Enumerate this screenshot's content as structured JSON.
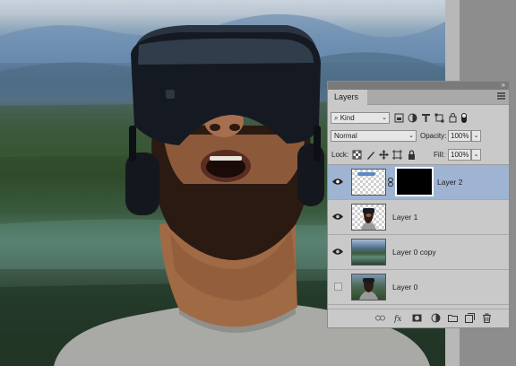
{
  "panel": {
    "tab_label": "Layers",
    "collapse_glyph": "»",
    "filter": {
      "kind_label": "Kind",
      "kind_icon": "search-icon"
    },
    "blend_mode": "Normal",
    "opacity_label": "Opacity:",
    "opacity_value": "100%",
    "lock_label": "Lock:",
    "fill_label": "Fill:",
    "fill_value": "100%",
    "layers": [
      {
        "name": "Layer 2",
        "visible": true,
        "selected": true,
        "has_mask": true,
        "thumb": "transparent-stroke"
      },
      {
        "name": "Layer 1",
        "visible": true,
        "selected": false,
        "has_mask": false,
        "thumb": "person-cutout"
      },
      {
        "name": "Layer 0 copy",
        "visible": true,
        "selected": false,
        "has_mask": false,
        "thumb": "landscape"
      },
      {
        "name": "Layer 0",
        "visible": false,
        "selected": false,
        "has_mask": false,
        "thumb": "photo"
      }
    ],
    "bottom_icons": [
      "link-layers-icon",
      "fx-icon",
      "add-mask-icon",
      "adjustment-layer-icon",
      "group-folder-icon",
      "new-layer-icon",
      "delete-trash-icon"
    ]
  },
  "colors": {
    "selection": "#9eb4d2",
    "panel_bg": "#c9c9c9"
  }
}
